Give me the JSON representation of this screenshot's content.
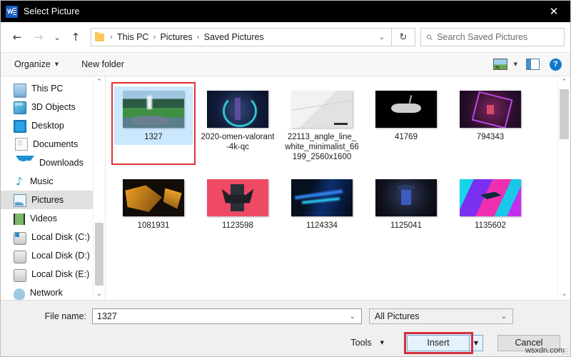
{
  "window": {
    "title": "Select Picture",
    "app_icon": "word-icon",
    "close_label": "✕"
  },
  "address_bar": {
    "back_icon": "←",
    "forward_icon": "→",
    "recent_icon": "⌄",
    "up_icon": "↑",
    "folder_icon": "folder-icon",
    "breadcrumbs": [
      "This PC",
      "Pictures",
      "Saved Pictures"
    ],
    "separator": "›",
    "dropdown_caret": "⌄",
    "refresh_icon": "↻",
    "search_placeholder": "Search Saved Pictures",
    "search_icon": "⚲"
  },
  "command_bar": {
    "organize_label": "Organize",
    "organize_caret": "▼",
    "new_folder_label": "New folder",
    "view_caret": "▼",
    "view_icon": "picture-view-icon",
    "pane_icon": "preview-pane-icon",
    "help_icon": "?"
  },
  "sidebar": {
    "items": [
      {
        "label": "This PC",
        "icon": "computer-icon",
        "selected": false
      },
      {
        "label": "3D Objects",
        "icon": "3d-objects-icon",
        "selected": false
      },
      {
        "label": "Desktop",
        "icon": "desktop-icon",
        "selected": false
      },
      {
        "label": "Documents",
        "icon": "documents-icon",
        "selected": false
      },
      {
        "label": "Downloads",
        "icon": "downloads-icon",
        "selected": false
      },
      {
        "label": "Music",
        "icon": "music-icon",
        "selected": false
      },
      {
        "label": "Pictures",
        "icon": "pictures-icon",
        "selected": true
      },
      {
        "label": "Videos",
        "icon": "videos-icon",
        "selected": false
      },
      {
        "label": "Local Disk (C:)",
        "icon": "system-disk-icon",
        "selected": false
      },
      {
        "label": "Local Disk (D:)",
        "icon": "disk-icon",
        "selected": false
      },
      {
        "label": "Local Disk (E:)",
        "icon": "disk-icon",
        "selected": false
      },
      {
        "label": "Network",
        "icon": "network-icon",
        "selected": false
      }
    ],
    "scroll_up_icon": "⌃",
    "scroll_down_icon": "⌄"
  },
  "files": {
    "items": [
      {
        "name": "1327",
        "art": "t-1327",
        "selected": true
      },
      {
        "name": "2020-omen-valorant-4k-qc",
        "art": "t-valorant",
        "selected": false
      },
      {
        "name": "22113_angle_line_white_minimalist_66199_2560x1600",
        "art": "t-angle",
        "selected": false
      },
      {
        "name": "41769",
        "art": "t-41769",
        "selected": false
      },
      {
        "name": "794343",
        "art": "t-794343",
        "selected": false
      },
      {
        "name": "1081931",
        "art": "t-1081931",
        "selected": false
      },
      {
        "name": "1123598",
        "art": "t-1123598",
        "selected": false
      },
      {
        "name": "1124334",
        "art": "t-1124334",
        "selected": false
      },
      {
        "name": "1125041",
        "art": "t-1125041",
        "selected": false
      },
      {
        "name": "1135602",
        "art": "t-1135602",
        "selected": false
      }
    ],
    "scroll_up_icon": "⌃",
    "scroll_down_icon": "⌄"
  },
  "footer": {
    "file_name_label": "File name:",
    "file_name_value": "1327",
    "file_name_caret": "⌄",
    "filter_value": "All Pictures",
    "filter_caret": "⌄",
    "tools_label": "Tools",
    "tools_caret": "▼",
    "insert_label": "Insert",
    "insert_split_caret": "▼",
    "cancel_label": "Cancel",
    "watermark": "wsxdn.com"
  },
  "highlight_color": "#d32f3f",
  "selection_color": "#cce8ff"
}
